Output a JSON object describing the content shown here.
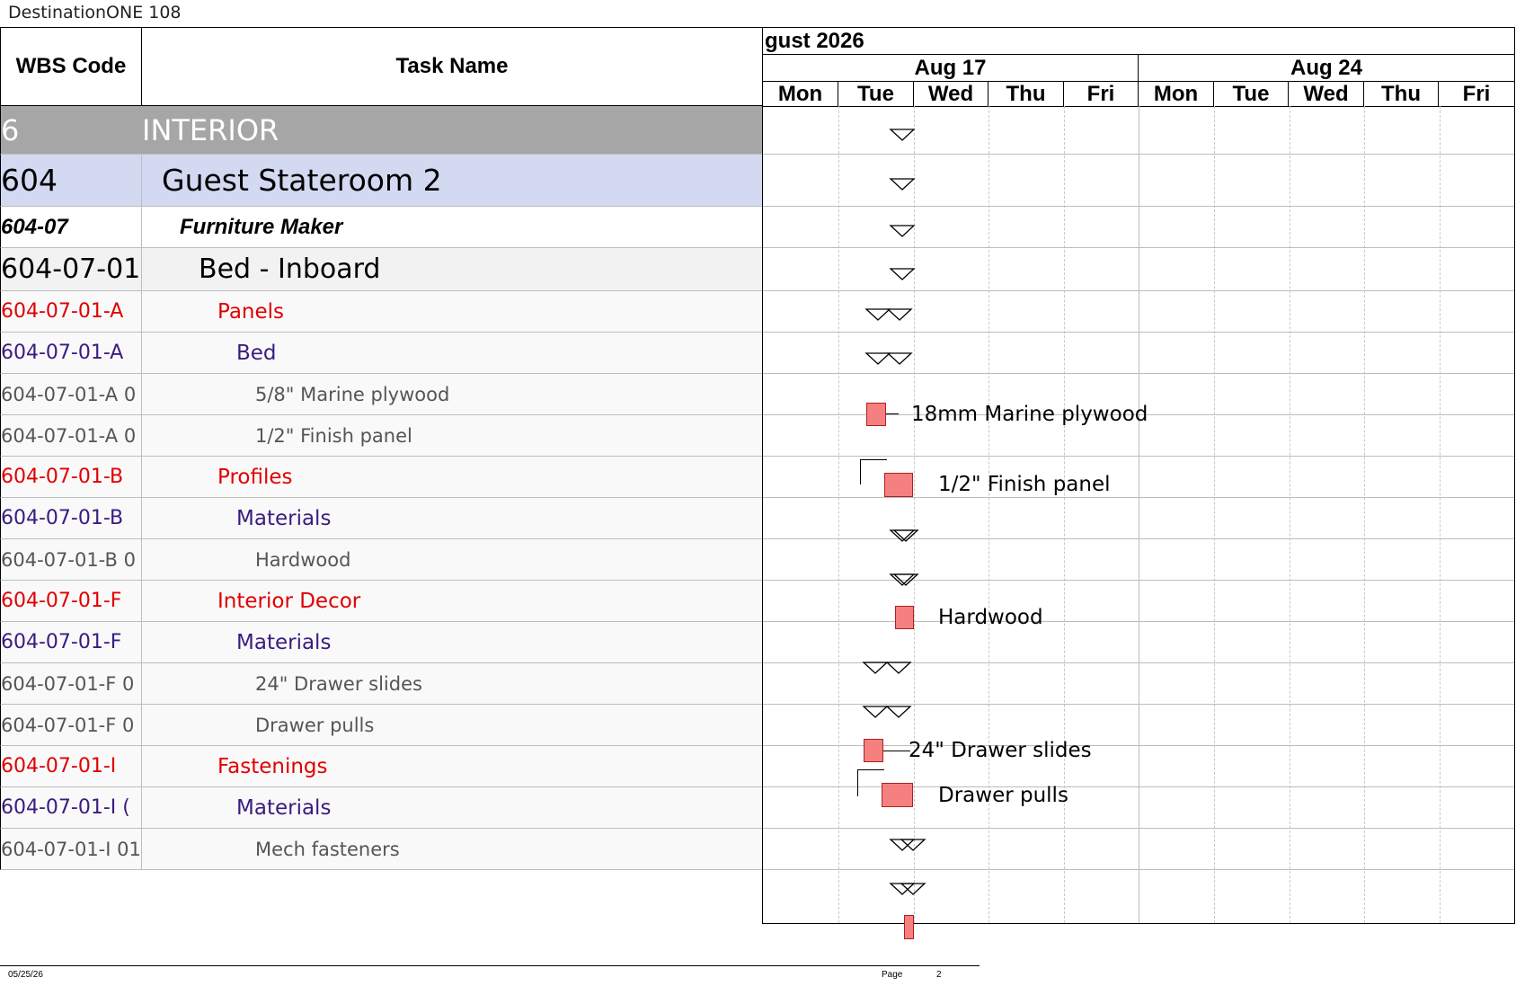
{
  "app": {
    "title": "DestinationONE 108"
  },
  "table": {
    "headers": {
      "wbs": "WBS Code",
      "task": "Task Name"
    }
  },
  "timeline": {
    "month": "gust 2026",
    "weeks": [
      "Aug 17",
      "Aug 24"
    ],
    "days": [
      "Mon",
      "Tue",
      "Wed",
      "Thu",
      "Fri",
      "Mon",
      "Tue",
      "Wed",
      "Thu",
      "Fri"
    ]
  },
  "rows": [
    {
      "wbs": "6",
      "task": "INTERIOR",
      "level": "section"
    },
    {
      "wbs": "604",
      "task": "Guest Stateroom 2",
      "level": "group"
    },
    {
      "wbs": "604-07",
      "task": "Furniture Maker",
      "level": "trade"
    },
    {
      "wbs": "604-07-01",
      "task": "Bed - Inboard",
      "level": "item"
    },
    {
      "wbs": "604-07-01-A",
      "task": "Panels",
      "level": "category"
    },
    {
      "wbs": "604-07-01-A",
      "task": "Bed",
      "level": "subcategory"
    },
    {
      "wbs": "604-07-01-A 0",
      "task": "5/8\" Marine plywood",
      "level": "task"
    },
    {
      "wbs": "604-07-01-A 0",
      "task": "1/2\" Finish panel",
      "level": "task"
    },
    {
      "wbs": "604-07-01-B",
      "task": "Profiles",
      "level": "category"
    },
    {
      "wbs": "604-07-01-B",
      "task": "Materials",
      "level": "subcategory"
    },
    {
      "wbs": "604-07-01-B 0",
      "task": "Hardwood",
      "level": "task"
    },
    {
      "wbs": "604-07-01-F",
      "task": "Interior Decor",
      "level": "category"
    },
    {
      "wbs": "604-07-01-F",
      "task": "Materials",
      "level": "subcategory"
    },
    {
      "wbs": "604-07-01-F 0",
      "task": "24\" Drawer slides",
      "level": "task"
    },
    {
      "wbs": "604-07-01-F 0",
      "task": "Drawer pulls",
      "level": "task"
    },
    {
      "wbs": "604-07-01-I",
      "task": "Fastenings",
      "level": "category"
    },
    {
      "wbs": "604-07-01-I (",
      "task": "Materials",
      "level": "subcategory"
    },
    {
      "wbs": "604-07-01-I 01",
      "task": "Mech fasteners",
      "level": "task"
    }
  ],
  "gantt_labels": {
    "plywood": "18mm Marine plywood",
    "finish_panel": "1/2\" Finish panel",
    "hardwood": "Hardwood",
    "drawer_slides": "24\" Drawer slides",
    "drawer_pulls": "Drawer pulls"
  },
  "footer": {
    "date": "05/25/26",
    "page_label": "Page",
    "page_number": "2"
  },
  "colors": {
    "section_bg": "#a6a6a6",
    "group_bg": "#d4d9f2",
    "item_bg": "#f2f2f2",
    "row_bg": "#f9f9f9",
    "category_text": "#e00000",
    "subcategory_text": "#3a1b80",
    "task_text": "#555555",
    "bar_fill": "#f4807f"
  }
}
